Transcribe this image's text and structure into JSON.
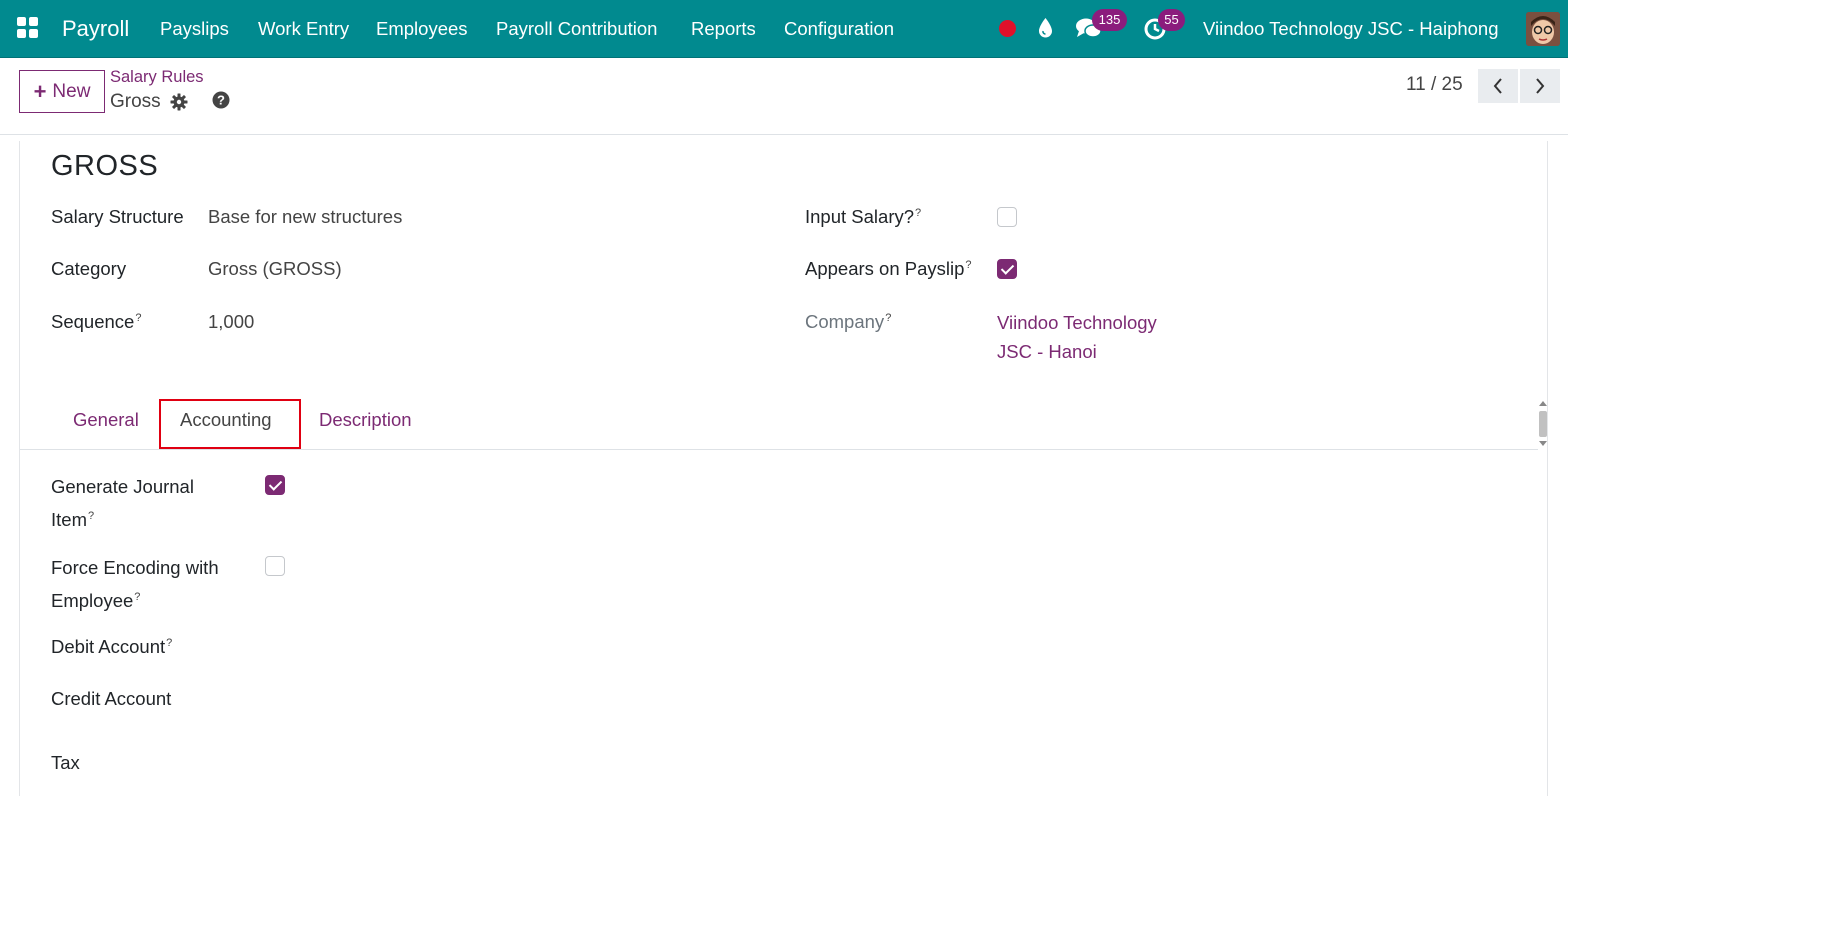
{
  "navbar": {
    "brand": "Payroll",
    "menu": [
      "Payslips",
      "Work Entry",
      "Employees",
      "Payroll Contribution",
      "Reports",
      "Configuration"
    ],
    "messages_count": "135",
    "activities_count": "55",
    "company": "Viindoo Technology JSC - Haiphong",
    "colors": {
      "bar": "#018a8f",
      "badge": "#8b1c7d",
      "record_dot": "#e0102a"
    }
  },
  "control": {
    "new_label": "New",
    "breadcrumb_parent": "Salary Rules",
    "breadcrumb_current": "Gross",
    "pager": "11 / 25"
  },
  "form": {
    "title": "GROSS",
    "salary_structure": {
      "label": "Salary Structure",
      "value": "Base for new structures"
    },
    "category": {
      "label": "Category",
      "value": "Gross (GROSS)"
    },
    "sequence": {
      "label": "Sequence",
      "help": "?",
      "value": "1,000"
    },
    "input_salary": {
      "label": "Input Salary?",
      "help": "?",
      "checked": false
    },
    "appears_on_payslip": {
      "label": "Appears on Payslip",
      "help": "?",
      "checked": true
    },
    "company": {
      "label": "Company",
      "help": "?",
      "value": "Viindoo Technology JSC - Hanoi"
    }
  },
  "tabs": [
    {
      "label": "General",
      "active": false
    },
    {
      "label": "Accounting",
      "active": true
    },
    {
      "label": "Description",
      "active": false
    }
  ],
  "accounting": {
    "generate_journal_item": {
      "label_line1": "Generate Journal",
      "label_line2": "Item",
      "help": "?",
      "checked": true
    },
    "force_encoding": {
      "label_line1": "Force Encoding with",
      "label_line2": "Employee",
      "help": "?",
      "checked": false
    },
    "debit_account": {
      "label": "Debit Account",
      "help": "?",
      "value": ""
    },
    "credit_account": {
      "label": "Credit Account",
      "value": ""
    },
    "tax": {
      "label": "Tax",
      "value": ""
    }
  }
}
